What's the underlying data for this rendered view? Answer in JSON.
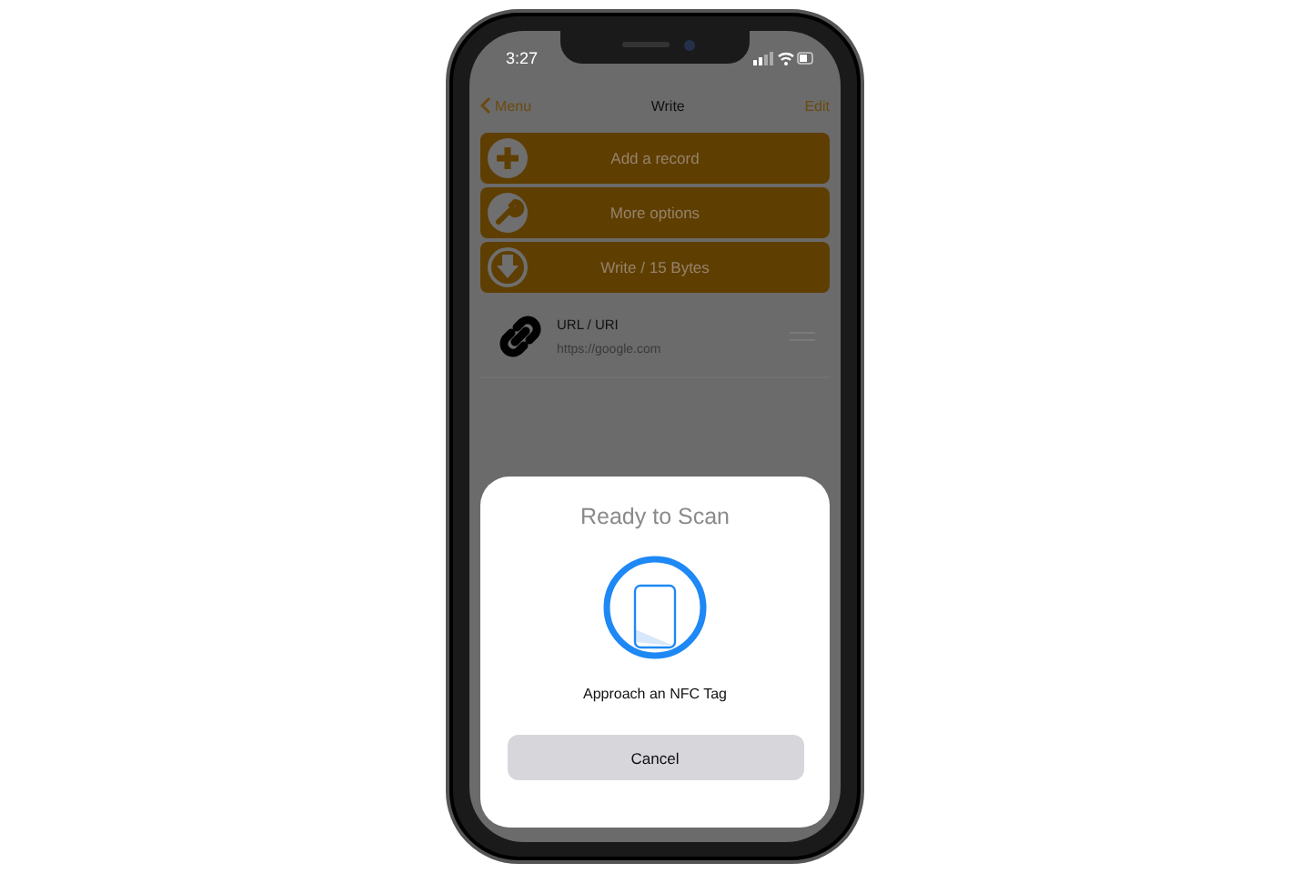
{
  "status_bar": {
    "time": "3:27"
  },
  "nav": {
    "back": "Menu",
    "title": "Write",
    "action": "Edit"
  },
  "actions": [
    {
      "kind": "add",
      "label": "Add a record"
    },
    {
      "kind": "options",
      "label": "More options"
    },
    {
      "kind": "write",
      "label": "Write / 15 Bytes"
    }
  ],
  "records": [
    {
      "type": "URL / URI",
      "value": "https://google.com"
    }
  ],
  "sheet": {
    "title": "Ready to Scan",
    "message": "Approach an NFC Tag",
    "cancel": "Cancel"
  }
}
